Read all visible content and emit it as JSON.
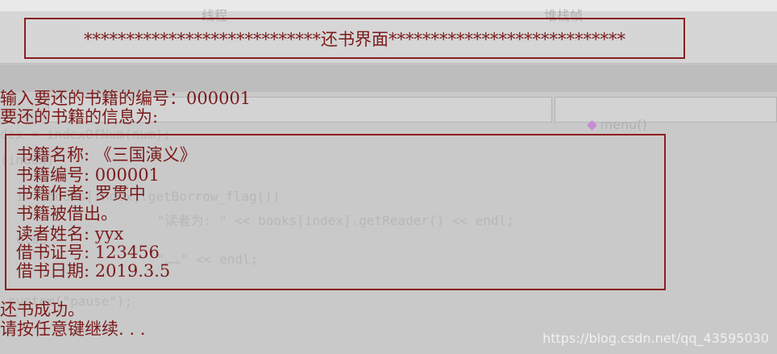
{
  "background": {
    "toolbar_label_a": "线程",
    "toolbar_label_b": "堆栈帧",
    "function_combo": "menu()",
    "code_lines": [
      "dex = indexOfNum(num);",
      "(index)",
      "if (books[index].getBorrow_flag())",
      "\"读者为: \" << books[index].getReader() << endl;",
      "else",
      "\"……\" << endl;",
      "system(\"pause\");"
    ]
  },
  "console": {
    "title": "****************************还书界面****************************",
    "prompt": "输入要还的书籍的编号：000001",
    "info_header": "要还的书籍的信息为:",
    "book": {
      "name": "书籍名称: 《三国演义》",
      "number": "书籍编号: 000001",
      "author": "书籍作者: 罗贯中",
      "status": "书籍被借出。",
      "reader": "读者姓名: yyx",
      "card": "借书证号: 123456",
      "date": "借书日期: 2019.3.5"
    },
    "result": "还书成功。",
    "continue": "请按任意键继续. . ."
  },
  "watermark": "https://blog.csdn.net/qq_43595030",
  "colors": {
    "console_text": "#7b1a1a",
    "frame": "#8b1f1f",
    "background": "#c9c9c9"
  }
}
